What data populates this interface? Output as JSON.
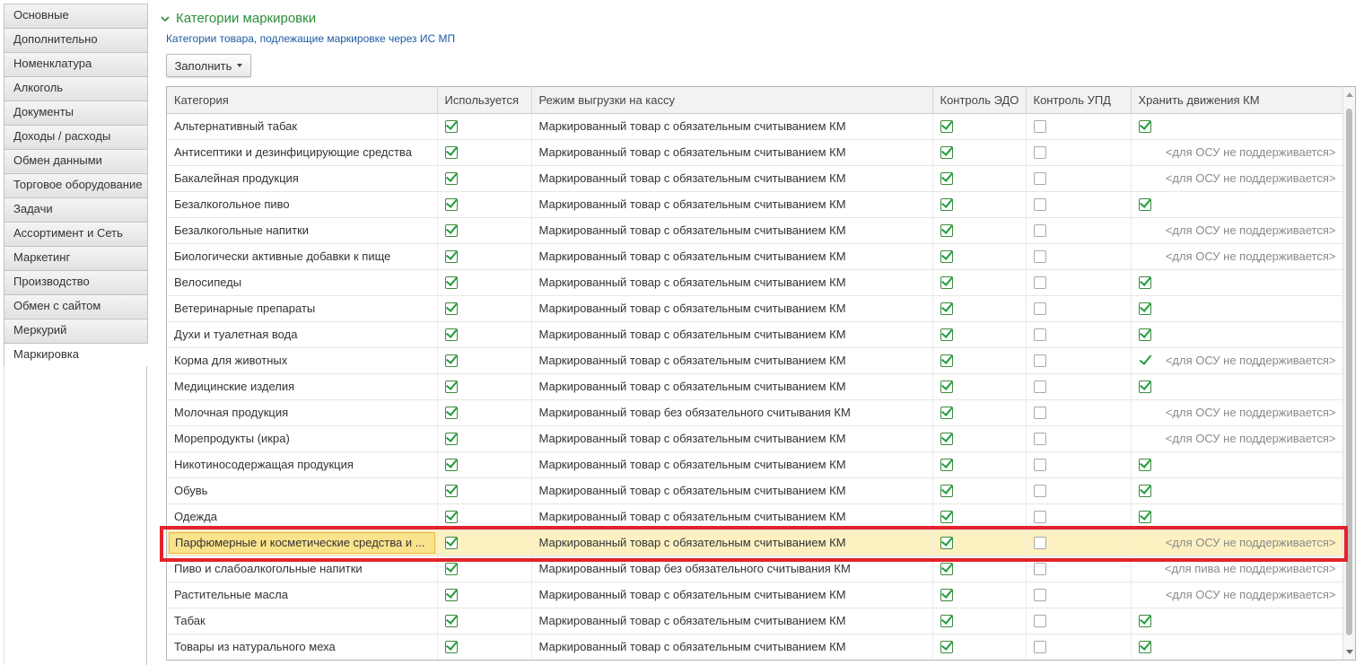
{
  "tabs": [
    {
      "label": "Основные"
    },
    {
      "label": "Дополнительно"
    },
    {
      "label": "Номенклатура"
    },
    {
      "label": "Алкоголь"
    },
    {
      "label": "Документы"
    },
    {
      "label": "Доходы / расходы"
    },
    {
      "label": "Обмен данными"
    },
    {
      "label": "Торговое оборудование"
    },
    {
      "label": "Задачи"
    },
    {
      "label": "Ассортимент и Сеть"
    },
    {
      "label": "Маркетинг"
    },
    {
      "label": "Производство"
    },
    {
      "label": "Обмен с сайтом"
    },
    {
      "label": "Меркурий"
    },
    {
      "label": "Маркировка",
      "active": true
    }
  ],
  "section": {
    "title": "Категории маркировки",
    "subtitle": "Категории товара, подлежащие маркировке через ИС МП",
    "fill_button": "Заполнить"
  },
  "table": {
    "columns": [
      "Категория",
      "Используется",
      "Режим выгрузки на кассу",
      "Контроль ЭДО",
      "Контроль УПД",
      "Хранить движения КМ"
    ],
    "rows": [
      {
        "category": "Альтернативный табак",
        "used": true,
        "mode": "Маркированный товар с обязательным считыванием КМ",
        "edo": true,
        "upd": false,
        "km": "check",
        "note": ""
      },
      {
        "category": "Антисептики и дезинфицирующие средства",
        "used": true,
        "mode": "Маркированный товар с обязательным считыванием КМ",
        "edo": true,
        "upd": false,
        "km": "na",
        "note": "<для ОСУ не поддерживается>"
      },
      {
        "category": "Бакалейная продукция",
        "used": true,
        "mode": "Маркированный товар с обязательным считыванием КМ",
        "edo": true,
        "upd": false,
        "km": "na",
        "note": "<для ОСУ не поддерживается>"
      },
      {
        "category": "Безалкогольное пиво",
        "used": true,
        "mode": "Маркированный товар с обязательным считыванием КМ",
        "edo": true,
        "upd": false,
        "km": "check",
        "note": ""
      },
      {
        "category": "Безалкогольные напитки",
        "used": true,
        "mode": "Маркированный товар с обязательным считыванием КМ",
        "edo": true,
        "upd": false,
        "km": "na",
        "note": "<для ОСУ не поддерживается>"
      },
      {
        "category": "Биологически активные добавки к пище",
        "used": true,
        "mode": "Маркированный товар с обязательным считыванием КМ",
        "edo": true,
        "upd": false,
        "km": "na",
        "note": "<для ОСУ не поддерживается>"
      },
      {
        "category": "Велосипеды",
        "used": true,
        "mode": "Маркированный товар с обязательным считыванием КМ",
        "edo": true,
        "upd": false,
        "km": "check",
        "note": ""
      },
      {
        "category": "Ветеринарные препараты",
        "used": true,
        "mode": "Маркированный товар с обязательным считыванием КМ",
        "edo": true,
        "upd": false,
        "km": "check",
        "note": ""
      },
      {
        "category": "Духи и туалетная вода",
        "used": true,
        "mode": "Маркированный товар с обязательным считыванием КМ",
        "edo": true,
        "upd": false,
        "km": "check",
        "note": ""
      },
      {
        "category": "Корма для животных",
        "used": true,
        "mode": "Маркированный товар с обязательным считыванием КМ",
        "edo": true,
        "upd": false,
        "km": "tick-na",
        "note": "<для ОСУ не поддерживается>"
      },
      {
        "category": "Медицинские изделия",
        "used": true,
        "mode": "Маркированный товар с обязательным считыванием КМ",
        "edo": true,
        "upd": false,
        "km": "check",
        "note": ""
      },
      {
        "category": "Молочная продукция",
        "used": true,
        "mode": "Маркированный товар без обязательного считывания КМ",
        "edo": true,
        "upd": false,
        "km": "na",
        "note": "<для ОСУ не поддерживается>"
      },
      {
        "category": "Морепродукты (икра)",
        "used": true,
        "mode": "Маркированный товар с обязательным считыванием КМ",
        "edo": true,
        "upd": false,
        "km": "na",
        "note": "<для ОСУ не поддерживается>"
      },
      {
        "category": "Никотиносодержащая продукция",
        "used": true,
        "mode": "Маркированный товар с обязательным считыванием КМ",
        "edo": true,
        "upd": false,
        "km": "check",
        "note": ""
      },
      {
        "category": "Обувь",
        "used": true,
        "mode": "Маркированный товар с обязательным считыванием КМ",
        "edo": true,
        "upd": false,
        "km": "check",
        "note": ""
      },
      {
        "category": "Одежда",
        "used": true,
        "mode": "Маркированный товар с обязательным считыванием КМ",
        "edo": true,
        "upd": false,
        "km": "check",
        "note": ""
      },
      {
        "category": "Парфюмерные и косметические средства и ...",
        "used": true,
        "mode": "Маркированный товар с обязательным считыванием КМ",
        "edo": true,
        "upd": false,
        "km": "na",
        "note": "<для ОСУ не поддерживается>",
        "selected": true
      },
      {
        "category": "Пиво и слабоалкогольные напитки",
        "used": true,
        "mode": "Маркированный товар без обязательного считывания КМ",
        "edo": true,
        "upd": false,
        "km": "na",
        "note": "<для пива не поддерживается>"
      },
      {
        "category": "Растительные масла",
        "used": true,
        "mode": "Маркированный товар с обязательным считыванием КМ",
        "edo": true,
        "upd": false,
        "km": "na",
        "note": "<для ОСУ не поддерживается>"
      },
      {
        "category": "Табак",
        "used": true,
        "mode": "Маркированный товар с обязательным считыванием КМ",
        "edo": true,
        "upd": false,
        "km": "check",
        "note": ""
      },
      {
        "category": "Товары из натурального меха",
        "used": true,
        "mode": "Маркированный товар с обязательным считыванием КМ",
        "edo": true,
        "upd": false,
        "km": "check",
        "note": ""
      }
    ]
  },
  "colors": {
    "section_title": "#2b8d3b",
    "subtitle": "#1c5aa5",
    "highlight_frame": "#e3232c",
    "selected_row": "#fdf1c2",
    "check": "#1f9c3c"
  }
}
